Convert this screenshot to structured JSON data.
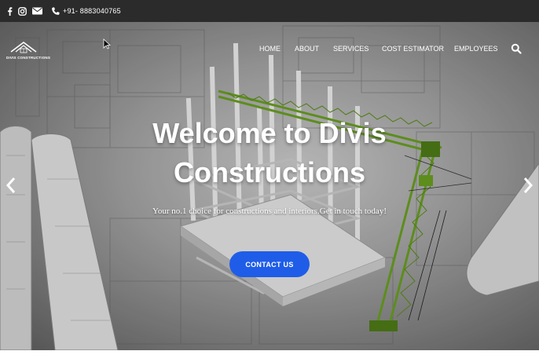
{
  "topbar": {
    "icons": [
      "facebook-icon",
      "instagram-icon",
      "mail-icon",
      "phone-icon"
    ],
    "phone": "+91- 8883040765"
  },
  "brand": {
    "logo_text": "DIVIS CONSTRUCTIONS"
  },
  "nav": {
    "items": [
      {
        "label": "HOME"
      },
      {
        "label": "ABOUT"
      },
      {
        "label": "SERVICES"
      },
      {
        "label": "COST ESTIMATOR"
      },
      {
        "label": "EMPLOYEES"
      }
    ],
    "search_icon": "search-icon"
  },
  "hero": {
    "title_line1": "Welcome to Divis",
    "title_line2": "Constructions",
    "subtitle": "Your no.1 choice for constructions and interiors.Get in touch today!",
    "cta_label": "CONTACT US",
    "prev_icon": "chevron-left-icon",
    "next_icon": "chevron-right-icon"
  },
  "colors": {
    "topbar_bg": "#2b2b2b",
    "cta_bg": "#1f5de8",
    "crane_green": "#6aa121",
    "text": "#ffffff"
  }
}
